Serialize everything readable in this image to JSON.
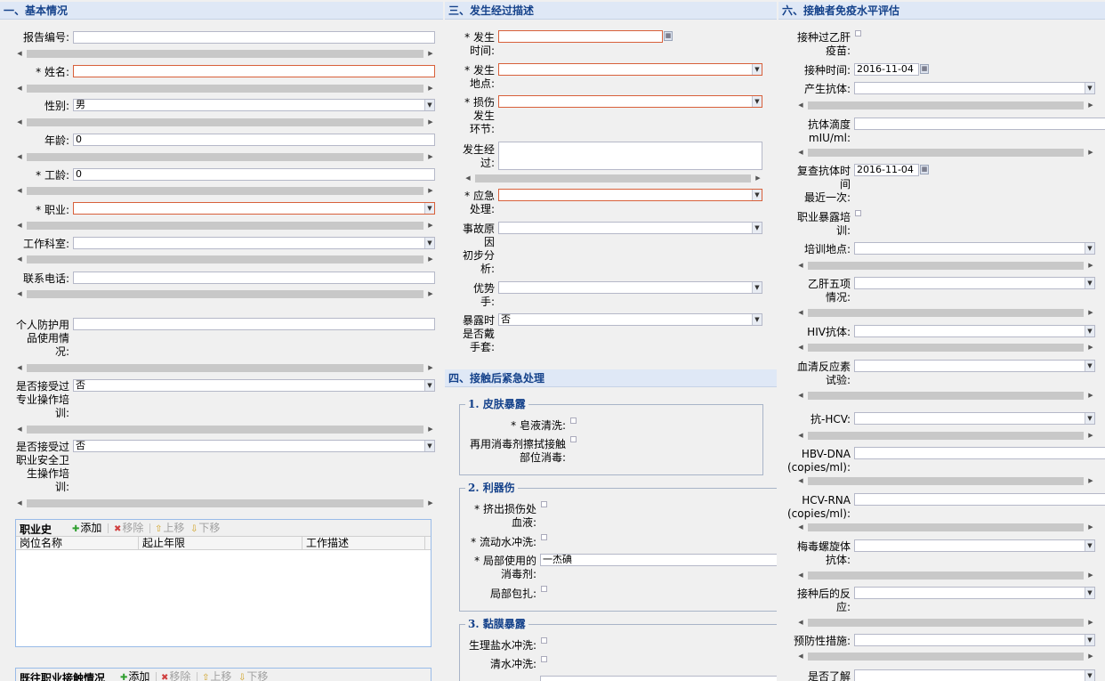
{
  "basic": {
    "title": "一、基本情况",
    "report_no": {
      "label": "报告编号:",
      "value": ""
    },
    "name": {
      "label": "* 姓名:",
      "value": ""
    },
    "gender": {
      "label": "性别:",
      "value": "男"
    },
    "age": {
      "label": "年龄:",
      "value": "0"
    },
    "work_years": {
      "label": "* 工龄:",
      "value": "0"
    },
    "occupation": {
      "label": "* 职业:",
      "value": ""
    },
    "department": {
      "label": "工作科室:",
      "value": ""
    },
    "phone": {
      "label": "联系电话:",
      "value": ""
    },
    "ppe": {
      "label_lines": [
        "个人防护用",
        "品使用情",
        "况:"
      ],
      "value": ""
    },
    "training": {
      "label_lines": [
        "是否接受过",
        "专业操作培",
        "训:"
      ],
      "value": "否"
    },
    "safety_training": {
      "label_lines": [
        "是否接受过",
        "职业安全卫",
        "生操作培",
        "训:"
      ],
      "value": "否"
    }
  },
  "job_history": {
    "title": "职业史",
    "buttons": {
      "add": "添加",
      "remove": "移除",
      "up": "上移",
      "down": "下移"
    },
    "columns": [
      "岗位名称",
      "起止年限",
      "工作描述"
    ]
  },
  "past_exposure": {
    "title": "既往职业接触情况",
    "buttons": {
      "add": "添加",
      "remove": "移除",
      "up": "上移",
      "down": "下移"
    }
  },
  "occurrence": {
    "title": "三、发生经过描述",
    "time": {
      "label_lines": [
        "* 发生",
        "时间:"
      ],
      "value": ""
    },
    "place": {
      "label_lines": [
        "* 发生",
        "地点:"
      ],
      "value": ""
    },
    "injury_stage": {
      "label_lines": [
        "* 损伤",
        "发生",
        "环节:"
      ],
      "value": ""
    },
    "process": {
      "label_lines": [
        "发生经",
        "过:"
      ],
      "value": ""
    },
    "emergency": {
      "label_lines": [
        "* 应急",
        "处理:"
      ],
      "value": ""
    },
    "cause": {
      "label_lines": [
        "事故原",
        "因",
        "初步分",
        "析:"
      ],
      "value": ""
    },
    "hand": {
      "label_lines": [
        "优势",
        "手:"
      ],
      "value": ""
    },
    "gloves": {
      "label_lines": [
        "暴露时",
        "是否戴",
        "手套:"
      ],
      "value": "否"
    }
  },
  "emergency_handling": {
    "title": "四、接触后紧急处理",
    "skin": {
      "legend": "1. 皮肤暴露",
      "soap_wash": {
        "label": "* 皂液清洗:"
      },
      "disinfect_lines": [
        "再用消毒剂擦拭接触",
        "部位消毒:"
      ]
    },
    "sharp": {
      "legend": "2. 利器伤",
      "squeeze_lines": [
        "* 挤出损伤处",
        "血液:"
      ],
      "flush": {
        "label": "* 流动水冲洗:"
      },
      "disinfectant_lines": [
        "* 局部使用的",
        "消毒剂:"
      ],
      "disinfectant_value": "一杰碘",
      "bandage": {
        "label": "局部包扎:"
      }
    },
    "mucosa": {
      "legend": "3. 黏膜暴露",
      "saline": {
        "label": "生理盐水冲洗:"
      },
      "water": {
        "label": "清水冲洗:"
      }
    }
  },
  "immunity": {
    "title": "六、接触者免疫水平评估",
    "hbv_vaccinated_lines": [
      "接种过乙肝",
      "疫苗:"
    ],
    "vacc_time": {
      "label": "接种时间:",
      "value": "2016-11-04"
    },
    "antibody": {
      "label": "产生抗体:",
      "value": ""
    },
    "titer_lines": [
      "抗体滴度",
      "mIU/ml:"
    ],
    "titer_value": "",
    "recheck_lines": [
      "复查抗体时",
      "间",
      "最近一次:"
    ],
    "recheck_value": "2016-11-04",
    "occ_training_lines": [
      "职业暴露培",
      "训:"
    ],
    "training_place": {
      "label": "培训地点:",
      "value": ""
    },
    "hbv_five_lines": [
      "乙肝五项",
      "情况:"
    ],
    "hbv_five_value": "",
    "hiv": {
      "label": "HIV抗体:",
      "value": ""
    },
    "serum_lines": [
      "血清反应素",
      "试验:"
    ],
    "serum_value": "",
    "hcv": {
      "label": "抗-HCV:",
      "value": ""
    },
    "hbv_dna_lines": [
      "HBV-DNA",
      "(copies/ml):"
    ],
    "hbv_dna_value": "",
    "hcv_rna_lines": [
      "HCV-RNA",
      "(copies/ml):"
    ],
    "hcv_rna_value": "",
    "syphilis_lines": [
      "梅毒螺旋体",
      "抗体:"
    ],
    "syphilis_value": "",
    "reaction_lines": [
      "接种后的反",
      "应:"
    ],
    "reaction_value": "",
    "prevention": {
      "label": "预防性措施:",
      "value": ""
    },
    "understand": {
      "label": "是否了解",
      "value": ""
    }
  }
}
